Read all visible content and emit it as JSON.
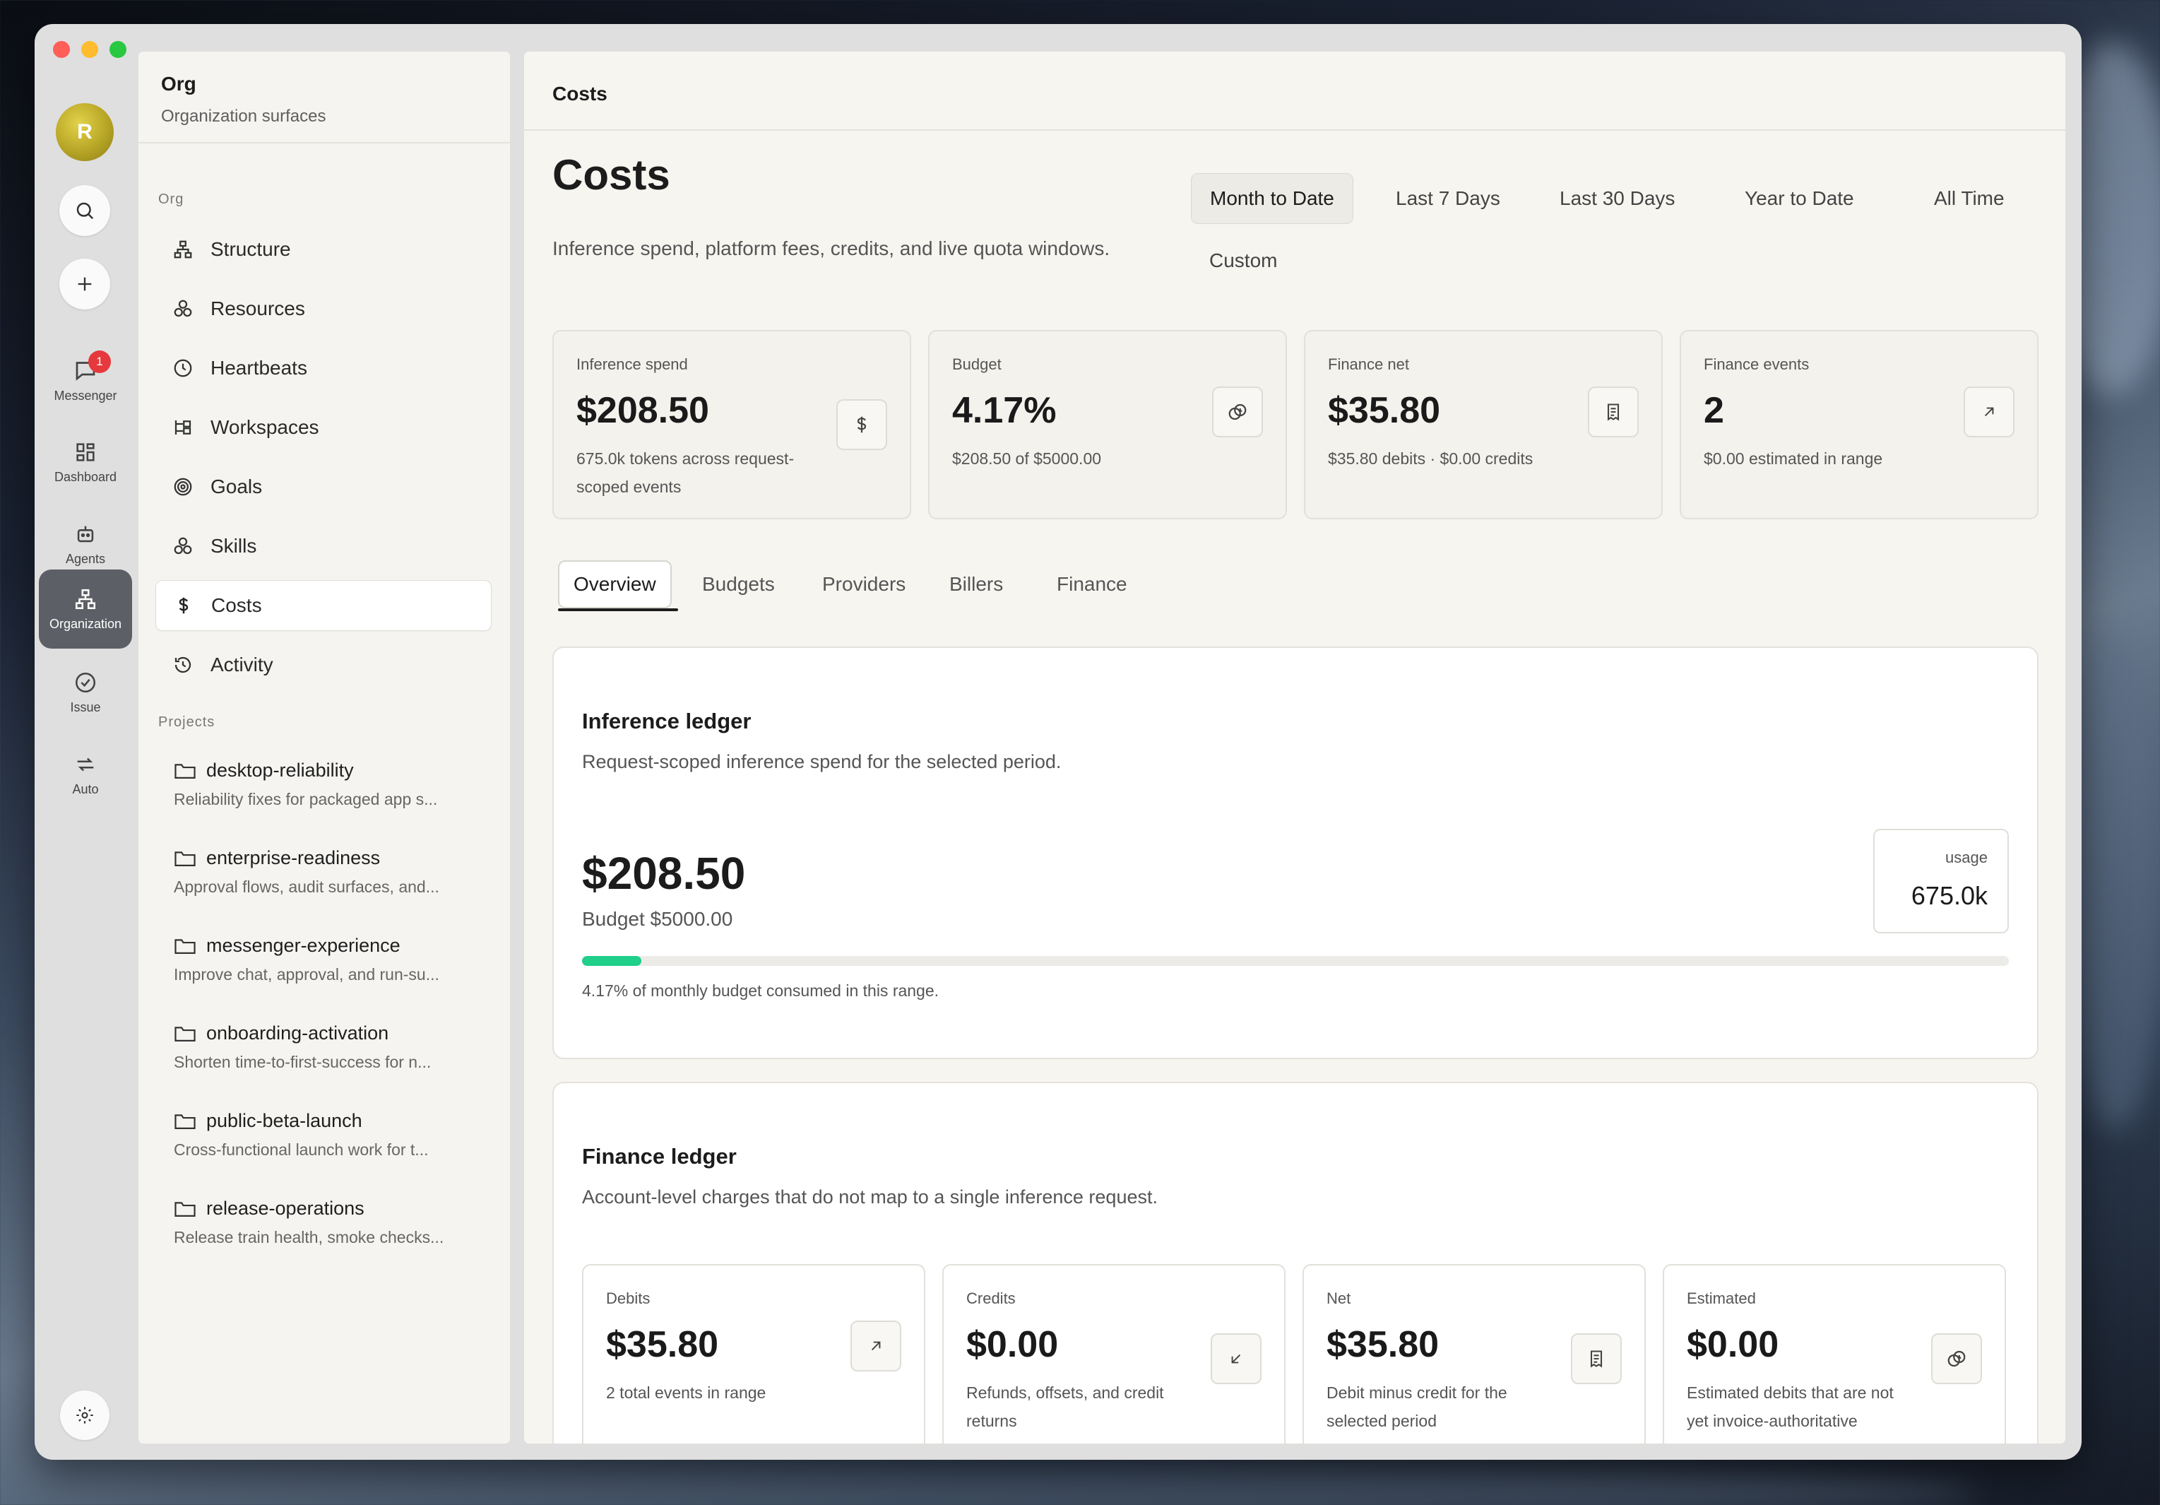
{
  "rail": {
    "avatar_initial": "R",
    "badge_count": "1",
    "items": [
      {
        "label": "Messenger"
      },
      {
        "label": "Dashboard"
      },
      {
        "label": "Agents"
      },
      {
        "label": "Organization"
      },
      {
        "label": "Issue"
      },
      {
        "label": "Auto"
      }
    ]
  },
  "sidebar": {
    "title": "Org",
    "subtitle": "Organization surfaces",
    "section_org": "Org",
    "items": [
      {
        "label": "Structure",
        "icon": "structure-icon"
      },
      {
        "label": "Resources",
        "icon": "resources-icon"
      },
      {
        "label": "Heartbeats",
        "icon": "clock-icon"
      },
      {
        "label": "Workspaces",
        "icon": "workspaces-icon"
      },
      {
        "label": "Goals",
        "icon": "target-icon"
      },
      {
        "label": "Skills",
        "icon": "skills-icon"
      },
      {
        "label": "Costs",
        "icon": "dollar-icon"
      },
      {
        "label": "Activity",
        "icon": "history-icon"
      }
    ],
    "section_projects": "Projects",
    "projects": [
      {
        "name": "desktop-reliability",
        "desc": "Reliability fixes for packaged app s..."
      },
      {
        "name": "enterprise-readiness",
        "desc": "Approval flows, audit surfaces, and..."
      },
      {
        "name": "messenger-experience",
        "desc": "Improve chat, approval, and run-su..."
      },
      {
        "name": "onboarding-activation",
        "desc": "Shorten time-to-first-success for n..."
      },
      {
        "name": "public-beta-launch",
        "desc": "Cross-functional launch work for t..."
      },
      {
        "name": "release-operations",
        "desc": "Release train health, smoke checks..."
      }
    ]
  },
  "main": {
    "breadcrumb": "Costs",
    "title": "Costs",
    "description": "Inference spend, platform fees, credits, and live quota windows.",
    "ranges": [
      "Month to Date",
      "Last 7 Days",
      "Last 30 Days",
      "Year to Date",
      "All Time",
      "Custom"
    ],
    "stats": [
      {
        "label": "Inference spend",
        "value": "$208.50",
        "sub": "675.0k tokens across request-scoped events",
        "icon": "dollar-icon"
      },
      {
        "label": "Budget",
        "value": "4.17%",
        "sub": "$208.50 of $5000.00",
        "icon": "coins-icon"
      },
      {
        "label": "Finance net",
        "value": "$35.80",
        "sub": "$35.80 debits · $0.00 credits",
        "icon": "receipt-icon"
      },
      {
        "label": "Finance events",
        "value": "2",
        "sub": "$0.00 estimated in range",
        "icon": "arrow-up-right-icon"
      }
    ],
    "tabs": [
      "Overview",
      "Budgets",
      "Providers",
      "Billers",
      "Finance"
    ],
    "inference_ledger": {
      "title": "Inference ledger",
      "description": "Request-scoped inference spend for the selected period.",
      "amount": "$208.50",
      "budget": "Budget $5000.00",
      "usage_label": "usage",
      "usage_value": "675.0k",
      "progress_fraction": 0.0417,
      "progress_note": "4.17% of monthly budget consumed in this range."
    },
    "finance_ledger": {
      "title": "Finance ledger",
      "description": "Account-level charges that do not map to a single inference request.",
      "cards": [
        {
          "label": "Debits",
          "value": "$35.80",
          "sub": "2 total events in range",
          "icon": "arrow-up-right-icon"
        },
        {
          "label": "Credits",
          "value": "$0.00",
          "sub": "Refunds, offsets, and credit returns",
          "icon": "arrow-down-left-icon"
        },
        {
          "label": "Net",
          "value": "$35.80",
          "sub": "Debit minus credit for the selected period",
          "icon": "receipt-icon"
        },
        {
          "label": "Estimated",
          "value": "$0.00",
          "sub": "Estimated debits that are not yet invoice-authoritative",
          "icon": "coins-icon"
        }
      ]
    }
  },
  "colors": {
    "accent_progress": "#1fcf8a",
    "badge": "#e5393d",
    "active_rail": "#5d5f66"
  }
}
